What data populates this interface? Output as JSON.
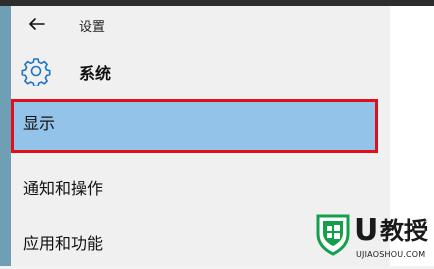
{
  "nav": {
    "back_icon": "back-arrow-icon",
    "breadcrumb": "设置"
  },
  "header": {
    "icon": "gear-icon",
    "title": "系统"
  },
  "menu": {
    "items": [
      {
        "label": "显示",
        "selected": true
      },
      {
        "label": "通知和操作",
        "selected": false
      },
      {
        "label": "应用和功能",
        "selected": false
      }
    ]
  },
  "watermark": {
    "brand": "U",
    "brand_cn": "教授",
    "domain": "UJIAOSHOU.COM"
  },
  "colors": {
    "accent_blue": "#1e73c8",
    "selected_bg": "#94c3ea",
    "highlight_border": "#e0101b",
    "watermark_green": "#14a04a"
  }
}
